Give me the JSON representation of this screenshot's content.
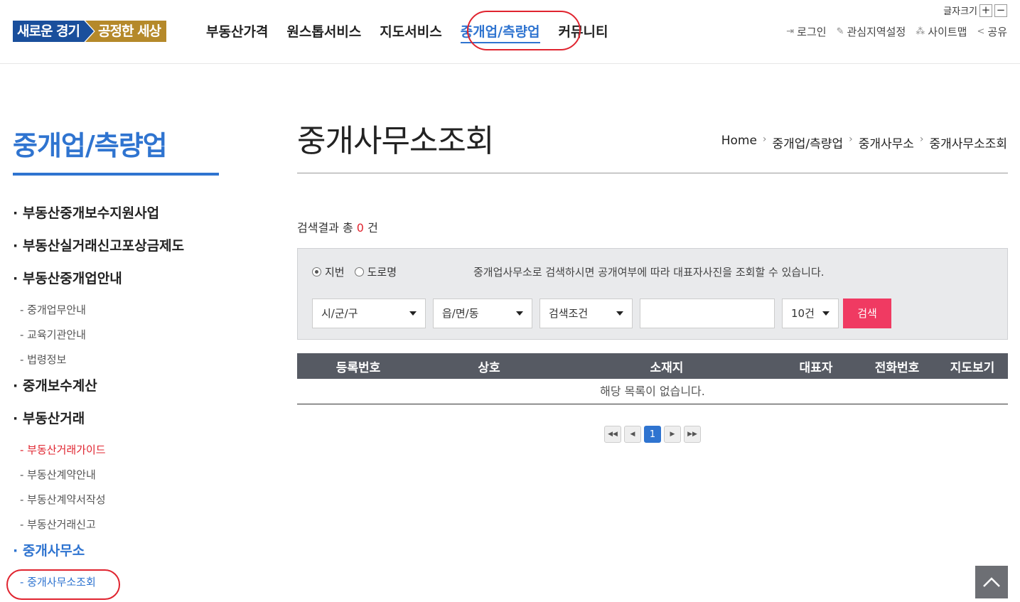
{
  "logo": {
    "part1": "새로운 경기",
    "part2": "공정한 세상"
  },
  "gnb": {
    "items": [
      {
        "label": "부동산가격"
      },
      {
        "label": "원스톱서비스"
      },
      {
        "label": "지도서비스"
      },
      {
        "label": "중개업/측량업"
      },
      {
        "label": "커뮤니티"
      }
    ],
    "active_index": 3
  },
  "fontsize": {
    "label": "글자크기",
    "plus": "+",
    "minus": "−"
  },
  "util": {
    "login": "로그인",
    "interest": "관심지역설정",
    "sitemap": "사이트맵",
    "share": "공유"
  },
  "lnb": {
    "title": "중개업/측량업",
    "menu": {
      "m1": "· 부동산중개보수지원사업",
      "m2": "· 부동산실거래신고포상금제도",
      "m3": "· 부동산중개업안내",
      "m3_1": "- 중개업무안내",
      "m3_2": "- 교육기관안내",
      "m3_3": "- 법령정보",
      "m4": "· 중개보수계산",
      "m5": "· 부동산거래",
      "m5_1": "- 부동산거래가이드",
      "m5_2": "- 부동산계약안내",
      "m5_3": "- 부동산계약서작성",
      "m5_4": "- 부동산거래신고",
      "m6": "· 중개사무소",
      "m6_1": "- 중개사무소조회"
    }
  },
  "content": {
    "title": "중개사무소조회",
    "breadcrumb": [
      "Home",
      "중개업/측량업",
      "중개사무소",
      "중개사무소조회"
    ],
    "result_prefix": "검색결과 총",
    "result_count": "0",
    "result_suffix": "건"
  },
  "search": {
    "radio_jibun": "지번",
    "radio_road": "도로명",
    "selected_radio": "지번",
    "notice": "중개업사무소로 검색하시면 공개여부에 따라 대표자사진을 조회할 수 있습니다.",
    "sel_city": "시/군/구",
    "sel_town": "읍/면/동",
    "sel_cond": "검색조건",
    "keyword": "",
    "sel_count": "10건",
    "button": "검색"
  },
  "table": {
    "headers": [
      "등록번호",
      "상호",
      "소재지",
      "대표자",
      "전화번호",
      "지도보기"
    ],
    "empty": "해당 목록이 없습니다."
  },
  "pager": {
    "current": "1"
  },
  "colors": {
    "accent": "#2f74d0",
    "highlight": "#e0242f",
    "search_button": "#f03a62"
  }
}
